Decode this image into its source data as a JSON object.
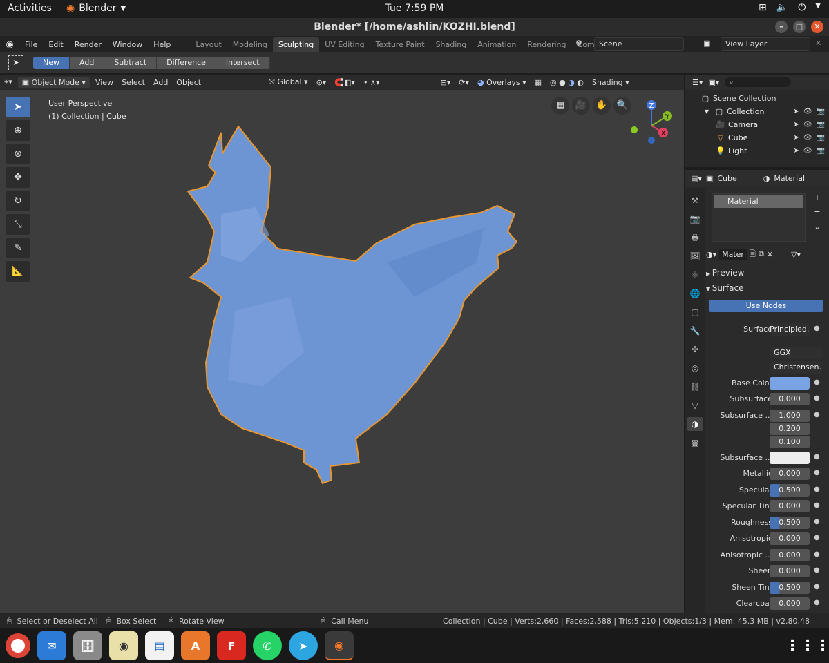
{
  "gnome": {
    "activities": "Activities",
    "app": "Blender",
    "clock": "Tue  7:59 PM"
  },
  "window": {
    "title": "Blender* [/home/ashlin/KOZHI.blend]"
  },
  "menu": {
    "items": [
      "File",
      "Edit",
      "Render",
      "Window",
      "Help"
    ]
  },
  "workspaces": {
    "tabs": [
      "Layout",
      "Modeling",
      "Sculpting",
      "UV Editing",
      "Texture Paint",
      "Shading",
      "Animation",
      "Rendering",
      "Compositing"
    ],
    "active": "Sculpting"
  },
  "scene": {
    "name": "Scene",
    "view_layer": "View Layer"
  },
  "toolrow": {
    "buttons": [
      "New",
      "Add",
      "Subtract",
      "Difference",
      "Intersect"
    ]
  },
  "vp_header": {
    "mode": "Object Mode",
    "view": "View",
    "select": "Select",
    "add": "Add",
    "object": "Object",
    "orientation": "Global",
    "overlays": "Overlays",
    "shading": "Shading"
  },
  "viewport": {
    "perspective": "User Perspective",
    "collection": "(1) Collection | Cube",
    "mesh_color": "#6d95d4",
    "outline_color": "#e9962c",
    "bg_color": "#3d3d3d"
  },
  "gizmo": {
    "z": "Z",
    "y": "Y",
    "x": "X"
  },
  "outliner": {
    "scene_collection": "Scene Collection",
    "collection": "Collection",
    "items": [
      "Camera",
      "Cube",
      "Light"
    ]
  },
  "properties": {
    "object": "Cube",
    "material_tab": "Material",
    "slot": "Material",
    "mat_name": "Materi",
    "preview": "Preview",
    "surface_section": "Surface",
    "use_nodes": "Use Nodes",
    "surface_label": "Surface",
    "surface_value": "Principled...",
    "distribution": "GGX",
    "subsurface_method": "Christensen...",
    "base_color_label": "Base Color",
    "base_color": "#7aa3e6",
    "subsurface": {
      "label": "Subsurface",
      "value": "0.000"
    },
    "subsurface_radius": {
      "label": "Subsurface ...",
      "values": [
        "1.000",
        "0.200",
        "0.100"
      ]
    },
    "subsurface_color": {
      "label": "Subsurface ...",
      "color": "#eeeeee"
    },
    "rows": [
      {
        "label": "Metallic",
        "value": "0.000",
        "fill": 0
      },
      {
        "label": "Specular",
        "value": "0.500",
        "fill": 0.5
      },
      {
        "label": "Specular Tint",
        "value": "0.000",
        "fill": 0
      },
      {
        "label": "Roughness",
        "value": "0.500",
        "fill": 0.5
      },
      {
        "label": "Anisotropic",
        "value": "0.000",
        "fill": 0
      },
      {
        "label": "Anisotropic ...",
        "value": "0.000",
        "fill": 0
      },
      {
        "label": "Sheen",
        "value": "0.000",
        "fill": 0
      },
      {
        "label": "Sheen Tint",
        "value": "0.500",
        "fill": 0.5
      },
      {
        "label": "Clearcoat",
        "value": "0.000",
        "fill": 0
      }
    ]
  },
  "status": {
    "select": "Select or Deselect All",
    "box": "Box Select",
    "rotate": "Rotate View",
    "menu": "Call Menu",
    "stats": "Collection | Cube | Verts:2,660 | Faces:2,588 | Tris:5,210 | Objects:1/3 | Mem: 45.3 MB | v2.80.48"
  },
  "dock": {
    "icons": [
      "chrome-icon",
      "thunderbird-icon",
      "files-icon",
      "rhythmbox-icon",
      "libreoffice-writer-icon",
      "software-center-icon",
      "foxit-icon",
      "whatsapp-icon",
      "telegram-icon",
      "blender-icon"
    ]
  }
}
